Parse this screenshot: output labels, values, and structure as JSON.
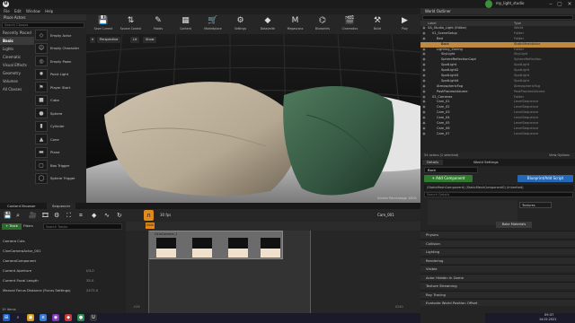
{
  "window": {
    "title": "my_light_studio",
    "menu": [
      "File",
      "Edit",
      "Window",
      "Help"
    ]
  },
  "place_actors": {
    "title": "Place Actors",
    "search_placeholder": "Search Classes",
    "categories": [
      "Recently Placed",
      "Basic",
      "Lights",
      "Cinematic",
      "Visual Effects",
      "Geometry",
      "Volumes",
      "All Classes"
    ],
    "active_category": "Basic",
    "items": [
      {
        "label": "Empty Actor",
        "icon": "◇"
      },
      {
        "label": "Empty Character",
        "icon": "☺"
      },
      {
        "label": "Empty Pawn",
        "icon": "◎"
      },
      {
        "label": "Point Light",
        "icon": "✹"
      },
      {
        "label": "Player Start",
        "icon": "⚑"
      },
      {
        "label": "Cube",
        "icon": "■"
      },
      {
        "label": "Sphere",
        "icon": "●"
      },
      {
        "label": "Cylinder",
        "icon": "▮"
      },
      {
        "label": "Cone",
        "icon": "▲"
      },
      {
        "label": "Plane",
        "icon": "▬"
      },
      {
        "label": "Box Trigger",
        "icon": "▢"
      },
      {
        "label": "Sphere Trigger",
        "icon": "◯"
      }
    ]
  },
  "toolbar": {
    "buttons": [
      {
        "label": "Save Current",
        "icon": "💾"
      },
      {
        "label": "Source Control",
        "icon": "⇅"
      },
      {
        "label": "Modes",
        "icon": "✎"
      },
      {
        "label": "Content",
        "icon": "▦"
      },
      {
        "label": "Marketplace",
        "icon": "🛒"
      },
      {
        "label": "Settings",
        "icon": "⚙"
      },
      {
        "label": "Datasmith",
        "icon": "◆"
      },
      {
        "label": "Megascans",
        "icon": "M"
      },
      {
        "label": "Blueprints",
        "icon": "⌬"
      },
      {
        "label": "Cinematics",
        "icon": "🎬"
      },
      {
        "label": "Build",
        "icon": "⚒"
      },
      {
        "label": "Play",
        "icon": "▶"
      }
    ]
  },
  "viewport": {
    "perspective": "Perspective",
    "lit": "Lit",
    "show": "Show",
    "footer_label": "Screen Percentage",
    "footer_value": "100%"
  },
  "outliner": {
    "title": "World Outliner",
    "columns": [
      "Label",
      "Type"
    ],
    "rows": [
      {
        "label": "SA_Studio_Light (Editor)",
        "type": "World",
        "indent": 0,
        "selected": false
      },
      {
        "label": "01_SceneSetup",
        "type": "Folder",
        "indent": 1,
        "selected": false
      },
      {
        "label": "Bed",
        "type": "Folder",
        "indent": 2,
        "selected": false
      },
      {
        "label": "Back",
        "type": "StaticMeshActor",
        "indent": 3,
        "selected": true
      },
      {
        "label": "Lighting_Zoning",
        "type": "Folder",
        "indent": 2,
        "selected": false
      },
      {
        "label": "SkyLight",
        "type": "SkyLight",
        "indent": 3,
        "selected": false
      },
      {
        "label": "SphereReflectionCapt",
        "type": "SphereReflection",
        "indent": 3,
        "selected": false
      },
      {
        "label": "SpotLight",
        "type": "SpotLight",
        "indent": 3,
        "selected": false
      },
      {
        "label": "SpotLight2",
        "type": "SpotLight",
        "indent": 3,
        "selected": false
      },
      {
        "label": "SpotLight3",
        "type": "SpotLight",
        "indent": 3,
        "selected": false
      },
      {
        "label": "SpotLight4",
        "type": "SpotLight",
        "indent": 3,
        "selected": false
      },
      {
        "label": "AtmosphericFog",
        "type": "AtmosphericFog",
        "indent": 2,
        "selected": false
      },
      {
        "label": "PostProcessVolume",
        "type": "PostProcessVolume",
        "indent": 2,
        "selected": false
      },
      {
        "label": "02_Cameras",
        "type": "Folder",
        "indent": 1,
        "selected": false
      },
      {
        "label": "Cam_01",
        "type": "LevelSequence",
        "indent": 2,
        "selected": false
      },
      {
        "label": "Cam_02",
        "type": "LevelSequence",
        "indent": 2,
        "selected": false
      },
      {
        "label": "Cam_03",
        "type": "LevelSequence",
        "indent": 2,
        "selected": false
      },
      {
        "label": "Cam_04",
        "type": "LevelSequence",
        "indent": 2,
        "selected": false
      },
      {
        "label": "Cam_05",
        "type": "LevelSequence",
        "indent": 2,
        "selected": false
      },
      {
        "label": "Cam_06",
        "type": "LevelSequence",
        "indent": 2,
        "selected": false
      },
      {
        "label": "Cam_07",
        "type": "LevelSequence",
        "indent": 2,
        "selected": false
      }
    ],
    "footer": "54 actors (1 selected)",
    "view_options": "View Options"
  },
  "details": {
    "tabs": [
      "Details",
      "World Settings"
    ],
    "actor_name": "Back",
    "add_component": "+ Add Component",
    "blueprint_script": "Blueprint/Add Script",
    "component_line": "(StaticMeshComponent) (StaticMeshComponent0) (Inherited)",
    "search_placeholder": "Search Details",
    "material_value": "Textures",
    "bake_materials": "Bake Materials",
    "sections": [
      "Physics",
      "Collision",
      "Lighting",
      "Rendering",
      "Visible",
      "Actor Hidden In Game",
      "Texture Streaming",
      "Ray Tracing",
      "Evaluate World Position Offset"
    ]
  },
  "sequencer": {
    "tabs": [
      "Content Browser",
      "Sequencer"
    ],
    "track_button": "+ Track",
    "filters": "Filters",
    "search_placeholder": "Search Tracks",
    "fps": "30 fps",
    "time": "0000",
    "sequence_name": "Cam_001",
    "tracks": [
      {
        "label": "Camera Cuts",
        "value": ""
      },
      {
        "label": "CineCameraActor_001",
        "value": ""
      },
      {
        "label": "CameraComponent",
        "value": ""
      },
      {
        "label": "Current Aperture",
        "value": "f/4.0"
      },
      {
        "label": "Current Focal Length",
        "value": "35.0"
      },
      {
        "label": "Manual Focus Distance (Focus Settings)",
        "value": "2472.0"
      }
    ],
    "items_count": "19 items",
    "shot_label": "CineCamera_1",
    "ruler_left": "-015",
    "ruler_right": "0240"
  },
  "taskbar": {
    "time": "09:37",
    "date": "14.02.2021"
  }
}
